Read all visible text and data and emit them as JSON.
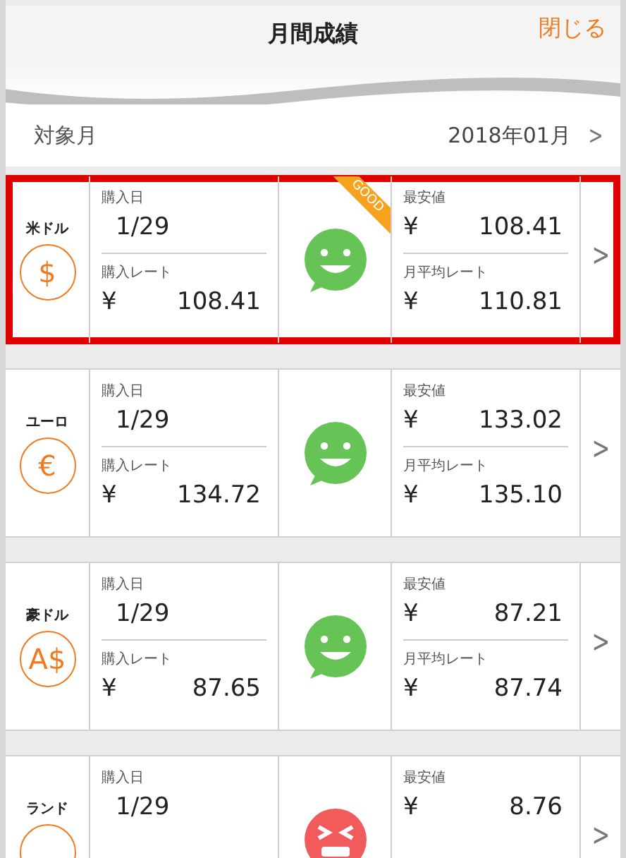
{
  "header": {
    "title": "月間成績",
    "close": "閉じる"
  },
  "month_row": {
    "label": "対象月",
    "value": "2018年01月",
    "chevron": ">"
  },
  "cards": [
    {
      "currency": "米ドル",
      "symbol": "$",
      "highlighted": true,
      "kind": "good",
      "badge": "GOOD",
      "purchase_date_label": "購入日",
      "purchase_date": "1/29",
      "purchase_rate_label": "購入レート",
      "purchase_rate_yen": "¥",
      "purchase_rate": "108.41",
      "lowest_label": "最安値",
      "lowest_yen": "¥",
      "lowest": "108.41",
      "average_label": "月平均レート",
      "average_yen": "¥",
      "average": "110.81",
      "chevron": ">"
    },
    {
      "currency": "ユーロ",
      "symbol": "€",
      "highlighted": false,
      "kind": "good",
      "purchase_date_label": "購入日",
      "purchase_date": "1/29",
      "purchase_rate_label": "購入レート",
      "purchase_rate_yen": "¥",
      "purchase_rate": "134.72",
      "lowest_label": "最安値",
      "lowest_yen": "¥",
      "lowest": "133.02",
      "average_label": "月平均レート",
      "average_yen": "¥",
      "average": "135.10",
      "chevron": ">"
    },
    {
      "currency": "豪ドル",
      "symbol": "A$",
      "highlighted": false,
      "kind": "good",
      "purchase_date_label": "購入日",
      "purchase_date": "1/29",
      "purchase_rate_label": "購入レート",
      "purchase_rate_yen": "¥",
      "purchase_rate": "87.65",
      "lowest_label": "最安値",
      "lowest_yen": "¥",
      "lowest": "87.21",
      "average_label": "月平均レート",
      "average_yen": "¥",
      "average": "87.74",
      "chevron": ">"
    },
    {
      "currency": "ランド",
      "highlighted": false,
      "kind": "bad",
      "purchase_date_label": "購入日",
      "purchase_date": "1/29",
      "lowest_label": "最安値",
      "lowest_yen": "¥",
      "lowest": "8.76",
      "chevron": ">"
    }
  ]
}
